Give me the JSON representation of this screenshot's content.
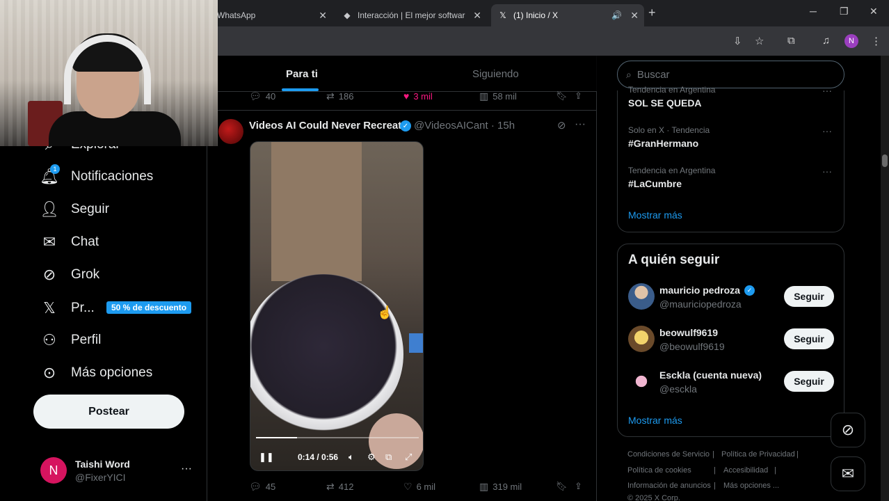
{
  "browser": {
    "tabs": [
      {
        "title": "WhatsApp"
      },
      {
        "title": "Interacción | El mejor software p"
      },
      {
        "title": "(1) Inicio / X"
      }
    ]
  },
  "nav": {
    "items": [
      {
        "label": "Explorar"
      },
      {
        "label": "Notificaciones"
      },
      {
        "label": "Seguir"
      },
      {
        "label": "Chat"
      },
      {
        "label": "Grok"
      },
      {
        "label": "Pr..."
      },
      {
        "label": "Perfil"
      },
      {
        "label": "Más opciones"
      }
    ],
    "notif_count": "1",
    "premium_badge": "50 % de descuento",
    "post_button": "Postear",
    "account": {
      "initial": "N",
      "name": "Taishi Word",
      "handle": "@FixerYICI"
    }
  },
  "feed": {
    "tabs": [
      {
        "label": "Para ti"
      },
      {
        "label": "Siguiendo"
      }
    ],
    "prev_actions": {
      "replies": "40",
      "reposts": "186",
      "likes": "3 mil",
      "views": "58 mil"
    },
    "tweet": {
      "author": "Videos AI Could Never Recreate",
      "handle": "@VideosAICant · 15h",
      "video": {
        "time": "0:14 / 0:56",
        "progress": 0.25
      },
      "actions": {
        "replies": "45",
        "reposts": "412",
        "likes": "6 mil",
        "views": "319 mil"
      }
    }
  },
  "right": {
    "search_placeholder": "Buscar",
    "trends": [
      {
        "category": "Tendencia en Argentina",
        "name": "SOL SE QUEDA"
      },
      {
        "category": "Solo en X · Tendencia",
        "name": "#GranHermano"
      },
      {
        "category": "Tendencia en Argentina",
        "name": "#LaCumbre"
      }
    ],
    "trends_more": "Mostrar más",
    "who_to_follow": {
      "title": "A quién seguir",
      "users": [
        {
          "name": "mauricio pedroza",
          "handle": "@mauriciopedroza",
          "button": "Seguir"
        },
        {
          "name": "beowulf9619",
          "handle": "@beowulf9619",
          "button": "Seguir"
        },
        {
          "name": "Esckla (cuenta nueva)",
          "handle": "@esckla",
          "button": "Seguir"
        }
      ],
      "more": "Mostrar más"
    },
    "footer": [
      "Condiciones de Servicio",
      "Política de Privacidad",
      "Política de cookies",
      "Accesibilidad",
      "Información de anuncios",
      "Más opciones ...",
      "© 2025 X Corp."
    ]
  },
  "colors": {
    "accent": "#1d9bf0",
    "like": "#f91880",
    "bg": "#000000"
  }
}
